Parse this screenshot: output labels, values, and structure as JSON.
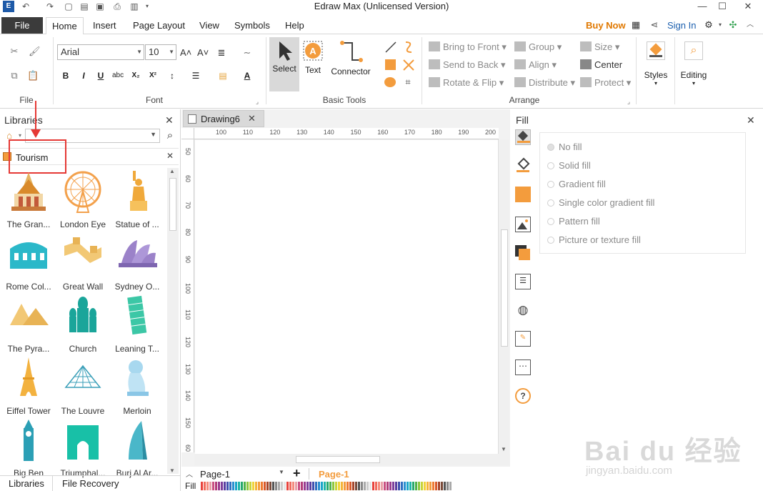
{
  "window": {
    "title": "Edraw Max (Unlicensed Version)",
    "minimize": "—",
    "maximize": "☐",
    "close": "✕"
  },
  "menu": {
    "file": "File",
    "tabs": [
      "Home",
      "Insert",
      "Page Layout",
      "View",
      "Symbols",
      "Help"
    ],
    "buy_now": "Buy Now",
    "sign_in": "Sign In"
  },
  "ribbon": {
    "font_name": "Arial",
    "font_size": "10",
    "groups": {
      "file": "File",
      "font": "Font",
      "basic_tools": "Basic Tools",
      "arrange": "Arrange"
    },
    "tools": {
      "select": "Select",
      "text": "Text",
      "connector": "Connector"
    },
    "arrange": {
      "bring_to_front": "Bring to Front",
      "send_to_back": "Send to Back",
      "rotate_flip": "Rotate & Flip",
      "group": "Group",
      "align": "Align",
      "distribute": "Distribute",
      "size": "Size",
      "center": "Center",
      "protect": "Protect"
    },
    "styles": "Styles",
    "editing": "Editing",
    "accent_color": "#f39c3d"
  },
  "libraries": {
    "title": "Libraries",
    "active_library": "Tourism",
    "shapes": [
      {
        "label": "The Gran...",
        "icon": "grand-palace-icon"
      },
      {
        "label": "London Eye",
        "icon": "london-eye-icon"
      },
      {
        "label": "Statue of ...",
        "icon": "statue-of-liberty-icon"
      },
      {
        "label": "Rome Col...",
        "icon": "colosseum-icon"
      },
      {
        "label": "Great Wall",
        "icon": "great-wall-icon"
      },
      {
        "label": "Sydney O...",
        "icon": "sydney-opera-icon"
      },
      {
        "label": "The Pyra...",
        "icon": "pyramids-icon"
      },
      {
        "label": "Church",
        "icon": "church-icon"
      },
      {
        "label": "Leaning T...",
        "icon": "leaning-tower-icon"
      },
      {
        "label": "Eiffel Tower",
        "icon": "eiffel-tower-icon"
      },
      {
        "label": "The Louvre",
        "icon": "louvre-icon"
      },
      {
        "label": "Merloin",
        "icon": "merlion-icon"
      },
      {
        "label": "Big Ben",
        "icon": "big-ben-icon"
      },
      {
        "label": "Triumphal...",
        "icon": "triumphal-arch-icon"
      },
      {
        "label": "Burj Al Ar...",
        "icon": "burj-al-arab-icon"
      }
    ],
    "bottom_tabs": [
      "Libraries",
      "File Recovery"
    ]
  },
  "document": {
    "tab_name": "Drawing6",
    "hruler": [
      "100",
      "110",
      "120",
      "130",
      "140",
      "150",
      "160",
      "170",
      "180",
      "190",
      "200"
    ],
    "vruler": [
      "50",
      "60",
      "70",
      "80",
      "90",
      "100",
      "110",
      "120",
      "130",
      "140",
      "150",
      "60"
    ],
    "page_select": "Page-1",
    "page_active": "Page-1",
    "fill_label": "Fill"
  },
  "fill": {
    "title": "Fill",
    "options": [
      "No fill",
      "Solid fill",
      "Gradient fill",
      "Single color gradient fill",
      "Pattern fill",
      "Picture or texture fill"
    ]
  },
  "watermark": {
    "text": "Bai du 经验",
    "url": "jingyan.baidu.com"
  }
}
